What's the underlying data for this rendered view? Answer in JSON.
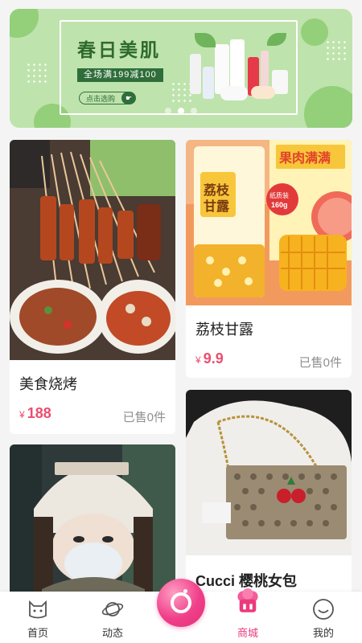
{
  "banner": {
    "title": "春日美肌",
    "promo": "全场满199减100",
    "cta": "点击选购",
    "slides": 3,
    "active_slide": 1
  },
  "products": [
    {
      "name": "美食烧烤",
      "currency": "¥",
      "price": "188",
      "sold": "已售0件",
      "image": "bbq-skewers-photo"
    },
    {
      "name": "荔枝甘露",
      "currency": "¥",
      "price": "9.9",
      "sold": "已售0件",
      "image": "lychee-drink-photo"
    },
    {
      "name": "",
      "image": "winter-hat-selfie-photo"
    },
    {
      "name": "Cucci 樱桃女包",
      "image": "cherry-bag-photo"
    }
  ],
  "drink_label": {
    "brand": "荔枝甘露",
    "badge": "纸质装 160g",
    "top_text": "果肉满满"
  },
  "tabs": [
    {
      "label": "首页",
      "icon": "home-cat-icon",
      "active": false
    },
    {
      "label": "动态",
      "icon": "planet-icon",
      "active": false
    },
    {
      "label": "",
      "icon": "camera-icon",
      "active": false
    },
    {
      "label": "商城",
      "icon": "shop-icon",
      "active": true
    },
    {
      "label": "我的",
      "icon": "smile-icon",
      "active": false
    }
  ],
  "colors": {
    "accent": "#ec4e6f",
    "tab_active": "#ea3a7d",
    "banner_bg": "#bfe3ad"
  }
}
